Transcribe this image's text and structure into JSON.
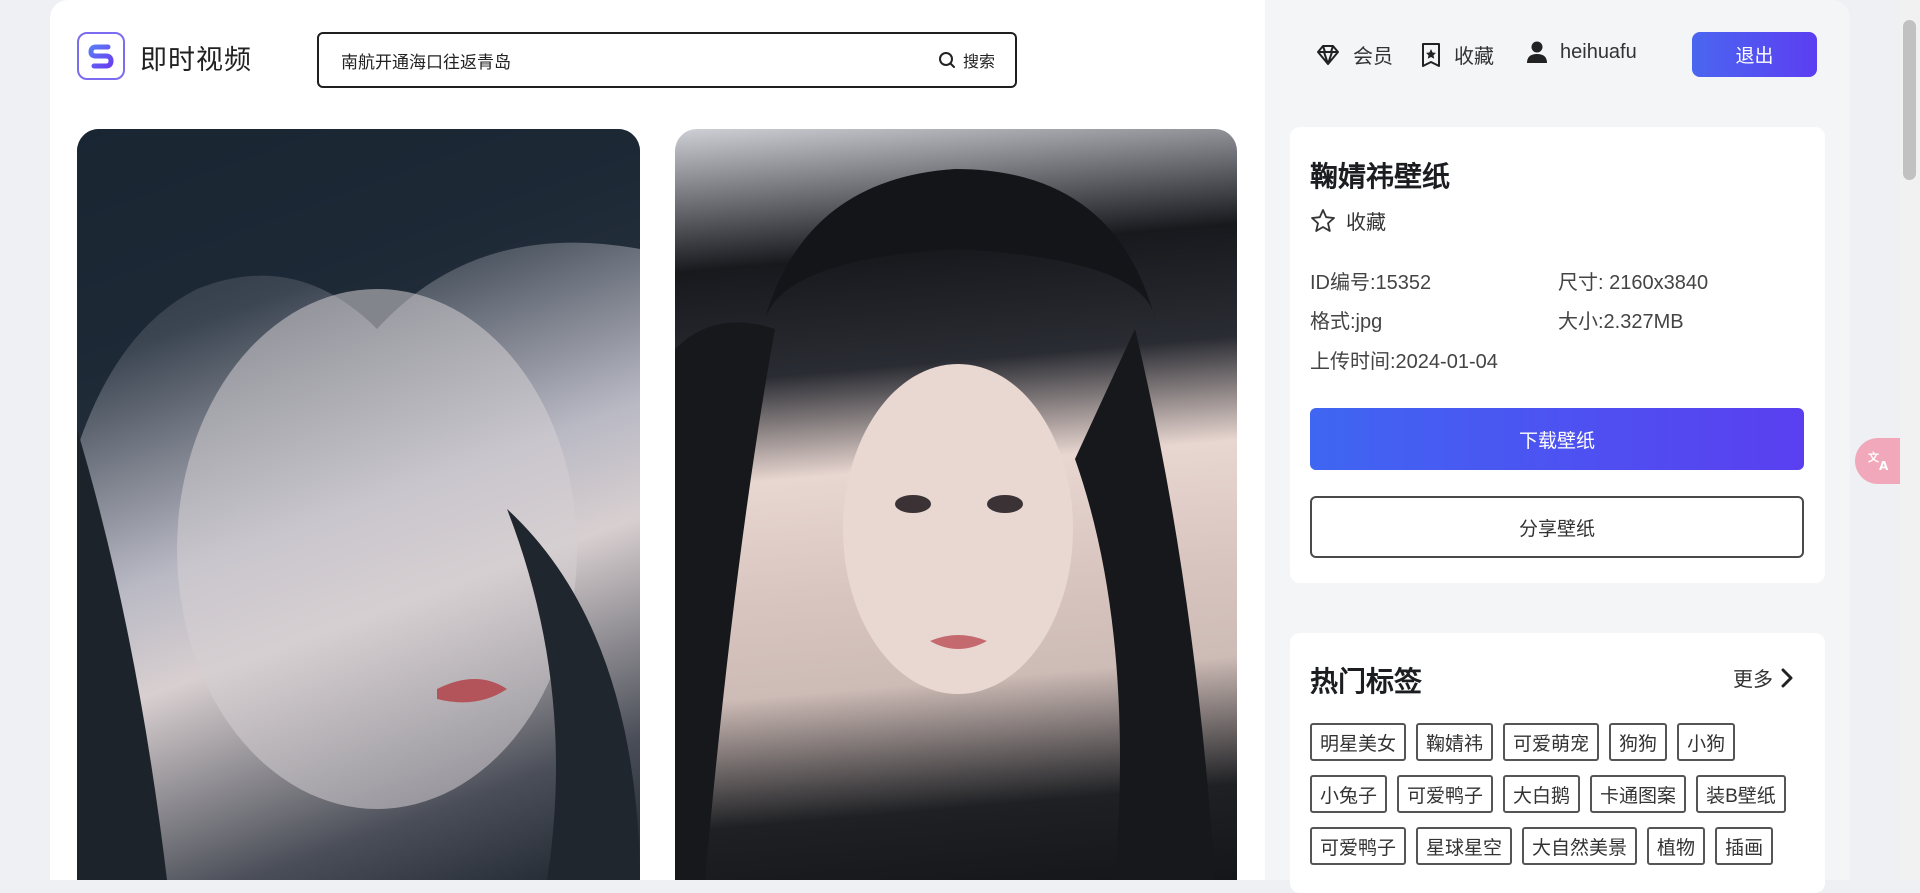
{
  "header": {
    "logo_text": "即时视频",
    "search": {
      "value": "南航开通海口往返青岛",
      "button_label": "搜索"
    },
    "nav": {
      "vip_label": "会员",
      "favorites_label": "收藏",
      "username": "heihuafu"
    },
    "logout_label": "退出"
  },
  "wallpaper": {
    "title": "鞠婧祎壁纸",
    "favorite_label": "收藏",
    "id_text": "ID编号:15352",
    "size_text": "尺寸: 2160x3840",
    "format_text": "格式:jpg",
    "filesize_text": "大小:2.327MB",
    "upload_text": "上传时间:2024-01-04",
    "download_label": "下载壁纸",
    "share_label": "分享壁纸"
  },
  "hot_tags": {
    "title": "热门标签",
    "more_label": "更多",
    "tags": [
      "明星美女",
      "鞠婧祎",
      "可爱萌宠",
      "狗狗",
      "小狗",
      "小兔子",
      "可爱鸭子",
      "大白鹅",
      "卡通图案",
      "装B壁纸",
      "可爱鸭子",
      "星球星空",
      "大自然美景",
      "植物",
      "插画"
    ]
  },
  "colors": {
    "accent_start": "#4a66f0",
    "accent_end": "#5c3ef2",
    "translate_badge": "#f2a8bb"
  },
  "icons": [
    "diamond-icon",
    "star-badge-icon",
    "user-icon",
    "search-icon",
    "star-outline-icon",
    "chevron-right-icon",
    "translate-icon"
  ]
}
